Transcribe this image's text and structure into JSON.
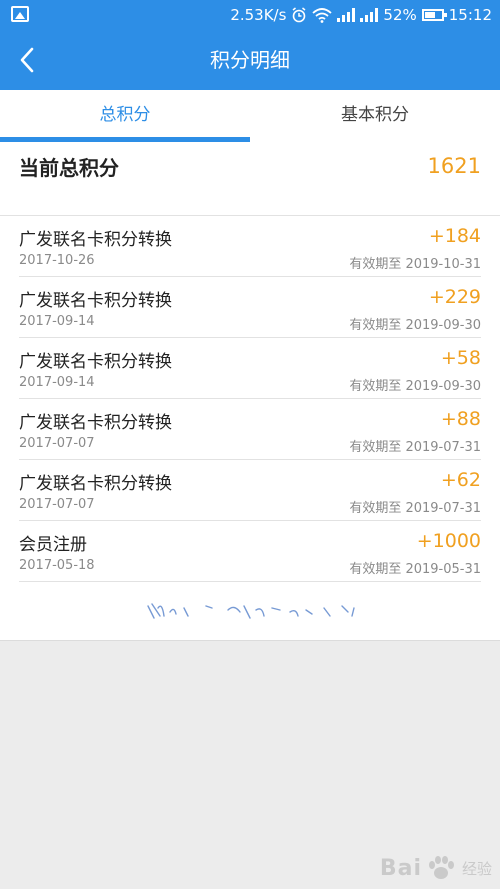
{
  "status_bar": {
    "net_speed": "2.53K/s",
    "battery": "52%",
    "time": "15:12",
    "icons": [
      "image-icon",
      "alarm-icon",
      "wifi-icon",
      "signal-icon",
      "signal-icon",
      "battery-icon"
    ]
  },
  "nav": {
    "title": "积分明细",
    "back_icon": "chevron-left-icon"
  },
  "tabs": [
    {
      "label": "总积分",
      "active": true
    },
    {
      "label": "基本积分",
      "active": false
    }
  ],
  "summary": {
    "label": "当前总积分",
    "value": "1621"
  },
  "records": [
    {
      "title": "广发联名卡积分转换",
      "points": "+184",
      "date": "2017-10-26",
      "expiry": "有效期至 2019-10-31"
    },
    {
      "title": "广发联名卡积分转换",
      "points": "+229",
      "date": "2017-09-14",
      "expiry": "有效期至 2019-09-30"
    },
    {
      "title": "广发联名卡积分转换",
      "points": "+58",
      "date": "2017-09-14",
      "expiry": "有效期至 2019-09-30"
    },
    {
      "title": "广发联名卡积分转换",
      "points": "+88",
      "date": "2017-07-07",
      "expiry": "有效期至 2019-07-31"
    },
    {
      "title": "广发联名卡积分转换",
      "points": "+62",
      "date": "2017-07-07",
      "expiry": "有效期至 2019-07-31"
    },
    {
      "title": "会员注册",
      "points": "+1000",
      "date": "2017-05-18",
      "expiry": "有效期至 2019-05-31"
    }
  ],
  "watermark": {
    "text": "Bai",
    "sub": "经验"
  },
  "colors": {
    "primary": "#2d8ee6",
    "points": "#f0a020",
    "muted_text": "#8a8a8a"
  }
}
